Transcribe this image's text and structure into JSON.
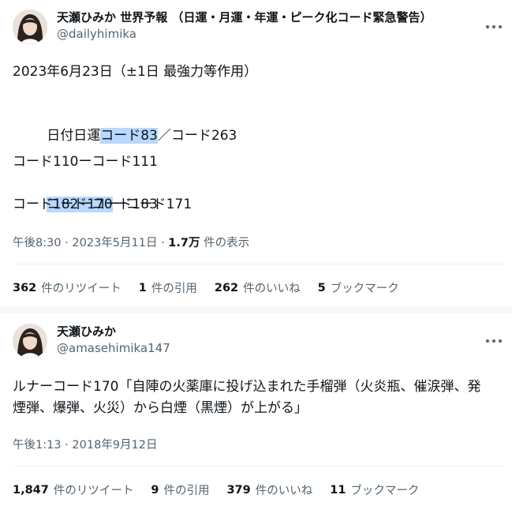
{
  "tweets": [
    {
      "display_name": "天瀬ひみか 世界予報 （日運・月運・年運・ピーク化コード緊急警告）",
      "handle": "@dailyhimika",
      "lines": {
        "l1": "2023年6月23日（±1日 最強力等作用）",
        "l2_pre": "日付日運",
        "l2_hl": "コード83",
        "l2_post": "／コード263",
        "l3": "コード110ーコード111",
        "l4_hl": "コード170",
        "l4_post": "ーコード171",
        "l5": "コード182ーコード183"
      },
      "timestamp": "午後8:30 · 2023年5月11日 · ",
      "views_count": "1.7万",
      "views_label": " 件の表示",
      "stats": [
        {
          "num": "362",
          "label": "件のリツイート"
        },
        {
          "num": "1",
          "label": "件の引用"
        },
        {
          "num": "262",
          "label": "件のいいね"
        },
        {
          "num": "5",
          "label": "ブックマーク"
        }
      ]
    },
    {
      "display_name": "天瀬ひみか",
      "handle": "@amasehimika147",
      "text": "ルナーコード170「自陣の火薬庫に投げ込まれた手榴弾（火炎瓶、催涙弾、発煙弾、爆弾、火災）から白煙（黒煙）が上がる」",
      "timestamp": "午後1:13 · 2018年9月12日",
      "stats": [
        {
          "num": "1,847",
          "label": "件のリツイート"
        },
        {
          "num": "9",
          "label": "件の引用"
        },
        {
          "num": "379",
          "label": "件のいいね"
        },
        {
          "num": "11",
          "label": "ブックマーク"
        }
      ]
    }
  ],
  "colors": {
    "highlight": "#b8d8ff",
    "secondary_text": "#536471",
    "primary_text": "#0f1419",
    "divider": "#eff3f4"
  },
  "icons": [
    "avatar-photo",
    "more-options-icon"
  ]
}
